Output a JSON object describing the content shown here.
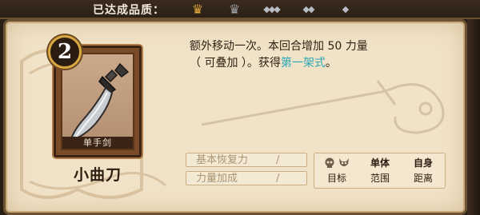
{
  "header": {
    "quality_label": "已达成品质：",
    "grade_icons": [
      "crown-gold-icon",
      "crown-silver-icon",
      "diamond-cluster-icon",
      "diamond-cluster-icon",
      "diamond-icon"
    ]
  },
  "card": {
    "cost": "2",
    "type": "单手剑",
    "name": "小曲刀",
    "art_icon": "curved-sword-icon"
  },
  "description": {
    "text_1": "额外移动一次。本回合增加 50 力量",
    "text_2": "（ 可叠加 ）。获得",
    "highlight": "第一架式",
    "text_3": "。",
    "highlight_color": "#2aa6b8"
  },
  "stats": [
    {
      "label": "基本恢复力",
      "value": "/"
    },
    {
      "label": "力量加成",
      "value": "/"
    }
  ],
  "target_info": {
    "target_icons": [
      "skull-icon",
      "demon-skull-icon"
    ],
    "target_label": "目标",
    "scope_value": "单体",
    "scope_label": "范围",
    "range_value": "自身",
    "range_label": "距离"
  },
  "colors": {
    "panel_bg": "#f1e3c8",
    "frame": "#6d5333",
    "badge_ring": "#d9a842"
  }
}
